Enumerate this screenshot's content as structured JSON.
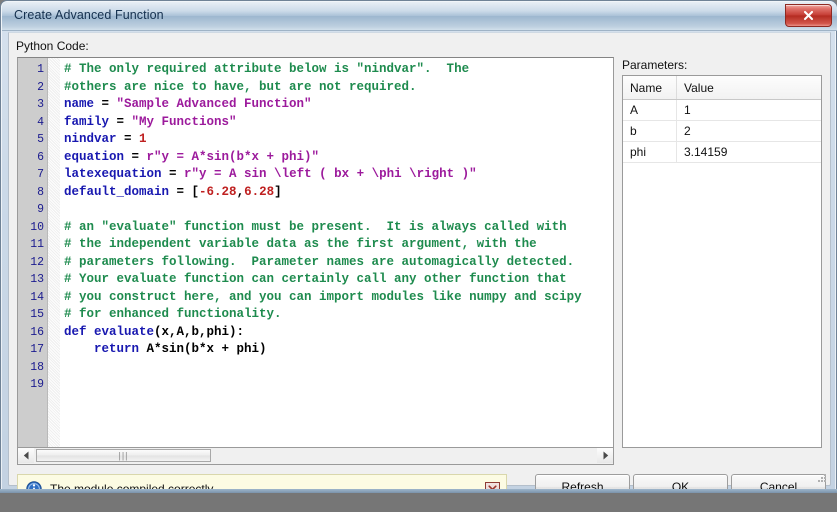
{
  "window": {
    "title": "Create Advanced Function",
    "close_icon": "close-x-icon"
  },
  "labels": {
    "python_code": "Python Code:",
    "parameters": "Parameters:"
  },
  "code": {
    "lines": [
      {
        "num": "1",
        "tokens": [
          {
            "t": "# The only required attribute below is \"nindvar\".  The",
            "c": "tok-comment"
          }
        ]
      },
      {
        "num": "2",
        "tokens": [
          {
            "t": "#others are nice to have, but are not required.",
            "c": "tok-comment"
          }
        ]
      },
      {
        "num": "3",
        "tokens": [
          {
            "t": "name",
            "c": "tok-kw"
          },
          {
            "t": " = ",
            "c": "tok-plain"
          },
          {
            "t": "\"Sample Advanced Function\"",
            "c": "tok-str"
          }
        ]
      },
      {
        "num": "4",
        "tokens": [
          {
            "t": "family",
            "c": "tok-kw"
          },
          {
            "t": " = ",
            "c": "tok-plain"
          },
          {
            "t": "\"My Functions\"",
            "c": "tok-str"
          }
        ]
      },
      {
        "num": "5",
        "tokens": [
          {
            "t": "nindvar",
            "c": "tok-kw"
          },
          {
            "t": " = ",
            "c": "tok-plain"
          },
          {
            "t": "1",
            "c": "tok-num"
          }
        ]
      },
      {
        "num": "6",
        "tokens": [
          {
            "t": "equation",
            "c": "tok-kw"
          },
          {
            "t": " = ",
            "c": "tok-plain"
          },
          {
            "t": "r\"y = A*sin(b*x + phi)\"",
            "c": "tok-str"
          }
        ]
      },
      {
        "num": "7",
        "tokens": [
          {
            "t": "latexequation",
            "c": "tok-kw"
          },
          {
            "t": " = ",
            "c": "tok-plain"
          },
          {
            "t": "r\"y = A sin \\left ( bx + \\phi \\right )\"",
            "c": "tok-str"
          }
        ]
      },
      {
        "num": "8",
        "tokens": [
          {
            "t": "default_domain",
            "c": "tok-kw"
          },
          {
            "t": " = [",
            "c": "tok-plain"
          },
          {
            "t": "-6.28",
            "c": "tok-num"
          },
          {
            "t": ",",
            "c": "tok-plain"
          },
          {
            "t": "6.28",
            "c": "tok-num"
          },
          {
            "t": "]",
            "c": "tok-plain"
          }
        ]
      },
      {
        "num": "9",
        "tokens": []
      },
      {
        "num": "10",
        "tokens": [
          {
            "t": "# an \"evaluate\" function must be present.  It is always called with",
            "c": "tok-comment"
          }
        ]
      },
      {
        "num": "11",
        "tokens": [
          {
            "t": "# the independent variable data as the first argument, with the",
            "c": "tok-comment"
          }
        ]
      },
      {
        "num": "12",
        "tokens": [
          {
            "t": "# parameters following.  Parameter names are automagically detected.",
            "c": "tok-comment"
          }
        ]
      },
      {
        "num": "13",
        "tokens": [
          {
            "t": "# Your evaluate function can certainly call any other function that",
            "c": "tok-comment"
          }
        ]
      },
      {
        "num": "14",
        "tokens": [
          {
            "t": "# you construct here, and you can import modules like numpy and scipy",
            "c": "tok-comment"
          }
        ]
      },
      {
        "num": "15",
        "tokens": [
          {
            "t": "# for enhanced functionality.",
            "c": "tok-comment"
          }
        ]
      },
      {
        "num": "16",
        "tokens": [
          {
            "t": "def",
            "c": "tok-kw"
          },
          {
            "t": " ",
            "c": "tok-plain"
          },
          {
            "t": "evaluate",
            "c": "tok-kw"
          },
          {
            "t": "(x,A,b,phi):",
            "c": "tok-plain"
          }
        ]
      },
      {
        "num": "17",
        "tokens": [
          {
            "t": "    ",
            "c": "tok-plain"
          },
          {
            "t": "return",
            "c": "tok-kw"
          },
          {
            "t": " A*sin(b*x + phi)",
            "c": "tok-plain"
          }
        ]
      },
      {
        "num": "18",
        "tokens": []
      },
      {
        "num": "19",
        "tokens": []
      }
    ],
    "scrollbar": {
      "left_arrow_icon": "triangle-left-icon",
      "right_arrow_icon": "triangle-right-icon",
      "grip_glyph": "|||"
    }
  },
  "parameters": {
    "columns": [
      "Name",
      "Value"
    ],
    "rows": [
      {
        "name": "A",
        "value": "1"
      },
      {
        "name": "b",
        "value": "2"
      },
      {
        "name": "phi",
        "value": "3.14159"
      }
    ]
  },
  "status": {
    "icon": "info-icon",
    "message": "The module compiled correctly.",
    "dismiss_icon": "close-x-icon"
  },
  "buttons": {
    "refresh": "Refresh",
    "ok": "OK",
    "cancel": "Cancel"
  },
  "colors": {
    "title_text": "#15314f",
    "close_button": "#c33a31",
    "status_bg": "#fcfbe3",
    "comment": "#1e8b4e",
    "keyword": "#1818b0",
    "string": "#9c1a9c",
    "number": "#bf2020"
  }
}
